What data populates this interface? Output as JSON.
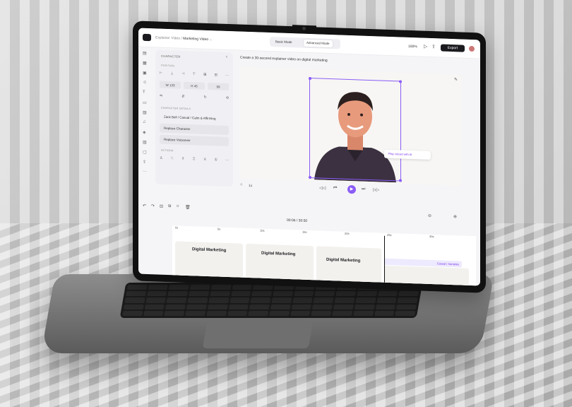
{
  "header": {
    "breadcrumb_parent": "Explainer Video",
    "project_name": "Marketing Video",
    "mode_basic": "Basic Mode",
    "mode_advanced": "Advanced Mode",
    "zoom": "100%",
    "export": "Export"
  },
  "panel": {
    "title": "CHARACTER",
    "position_label": "POSITION",
    "w_value": "W 133",
    "h_value": "H 45",
    "opacity_value": "99",
    "details_label": "CHARACTER DETAILS",
    "character_details": "Zack Bell / Casual / Calm & Affirming",
    "replace_character": "Replace Character",
    "replace_voiceover": "Replace Voiceover",
    "actions_label": "ACTIONS"
  },
  "editor": {
    "prompt": "Create a 30-second explainer video on digital marketing",
    "voice_tag": "Play voiced with AI",
    "speed": "1x",
    "time_display": "00:06 / 30:50"
  },
  "timeline": {
    "ticks": [
      "0s",
      "5s",
      "10s",
      "15s",
      "20s",
      "25s",
      "30s"
    ],
    "scene_title": "Digital Marketing",
    "range_label": "Casual | Samples",
    "accent": "#8b5cf6"
  }
}
